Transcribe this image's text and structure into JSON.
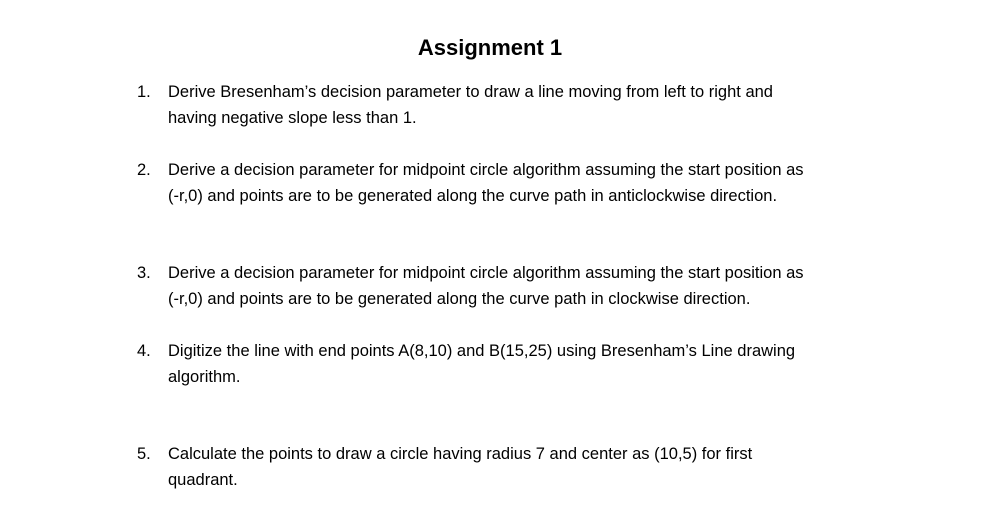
{
  "document": {
    "title": "Assignment 1",
    "items": [
      {
        "number": "1.",
        "line1": "Derive Bresenham’s decision parameter to draw a line moving from left to right and",
        "line2": "having negative slope less than 1."
      },
      {
        "number": "2.",
        "line1": "Derive a decision parameter for midpoint circle algorithm assuming the start position as",
        "line2": "(-r,0) and points are to be generated along the curve path in anticlockwise direction."
      },
      {
        "number": "3.",
        "line1": "Derive a decision parameter for midpoint circle algorithm assuming the start position as",
        "line2": "(-r,0) and points are to be generated along the curve path in clockwise direction."
      },
      {
        "number": "4.",
        "line1": "Digitize the line with end points A(8,10) and B(15,25) using Bresenham’s Line drawing",
        "line2": "algorithm."
      },
      {
        "number": "5.",
        "line1": "Calculate the points to draw a circle having radius 7 and center as (10,5) for first",
        "line2": "quadrant."
      }
    ]
  }
}
